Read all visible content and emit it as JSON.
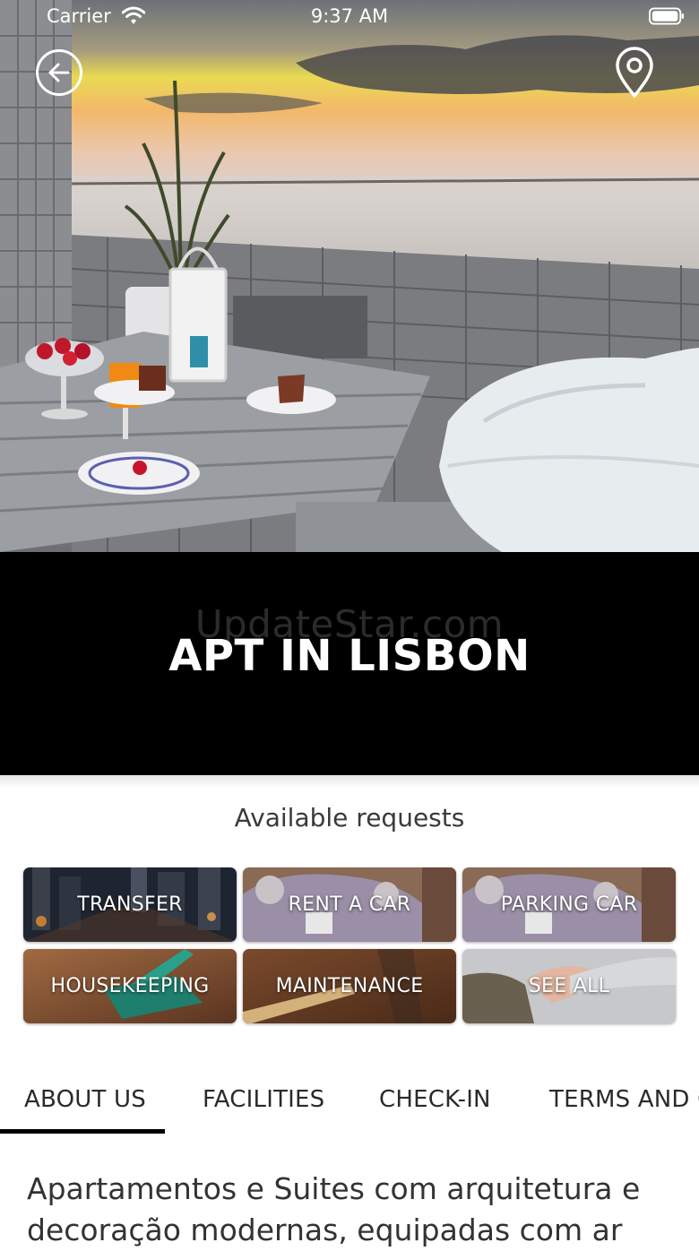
{
  "status_bar": {
    "carrier": "Carrier",
    "time": "9:37 AM"
  },
  "header": {
    "back_icon": "arrow-left-circle-icon",
    "location_icon": "map-pin-icon"
  },
  "hero": {
    "watermark": "UpdateStar.com",
    "title": "APT IN LISBON"
  },
  "requests": {
    "title": "Available requests",
    "items": [
      {
        "label": "TRANSFER"
      },
      {
        "label": "RENT A CAR"
      },
      {
        "label": "PARKING CAR"
      },
      {
        "label": "HOUSEKEEPING"
      },
      {
        "label": "MAINTENANCE"
      },
      {
        "label": "SEE ALL"
      }
    ]
  },
  "tabs": [
    {
      "label": "ABOUT US",
      "active": true
    },
    {
      "label": "FACILITIES"
    },
    {
      "label": "CHECK-IN"
    },
    {
      "label": "TERMS AND CONDITIONS"
    }
  ],
  "about": {
    "line1": "Apartamentos e Suites com arquitetura e",
    "line2": "decoração modernas, equipadas com ar"
  },
  "colors": {
    "title_band": "#000000",
    "tab_indicator": "#000000",
    "text": "#333333"
  }
}
